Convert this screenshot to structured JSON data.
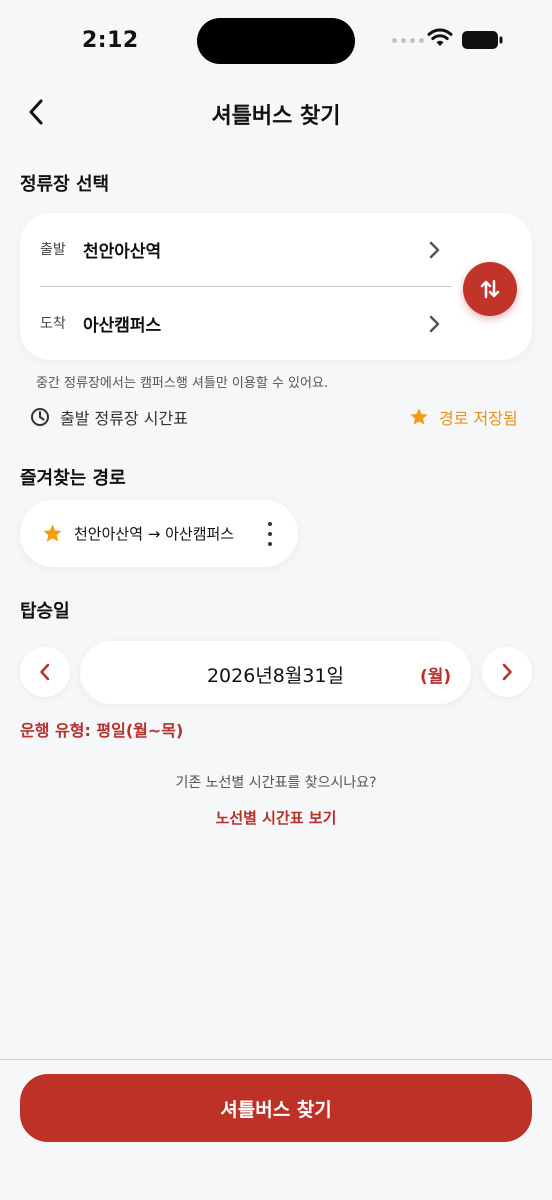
{
  "status_bar": {
    "time": "2:12"
  },
  "header": {
    "title": "셔틀버스 찾기"
  },
  "stations": {
    "section_title": "정류장 선택",
    "departure": {
      "tag": "출발",
      "name": "천안아산역"
    },
    "arrival": {
      "tag": "도착",
      "name": "아산캠퍼스"
    },
    "hint": "중간 정류장에서는 캠퍼스행 셔틀만 이용할 수 있어요.",
    "timetable_label": "출발 정류장 시간표",
    "saved_label": "경로 저장됨"
  },
  "favorites": {
    "section_title": "즐겨찾는 경로",
    "items": [
      {
        "label": "천안아산역 → 아산캠퍼스"
      }
    ]
  },
  "boarding_date": {
    "section_title": "탑승일",
    "date": "2026년8월31일",
    "weekday": "(월)",
    "service_type": "운행 유형: 평일(월~목)"
  },
  "route_timetable": {
    "question": "기존 노선별 시간표를 찾으시나요?",
    "link": "노선별 시간표 보기"
  },
  "footer": {
    "find_button": "셔틀버스 찾기"
  },
  "colors": {
    "accent": "#bd3127",
    "star": "#f29d12",
    "saved": "#e8911b",
    "background": "#f6f7f9"
  }
}
